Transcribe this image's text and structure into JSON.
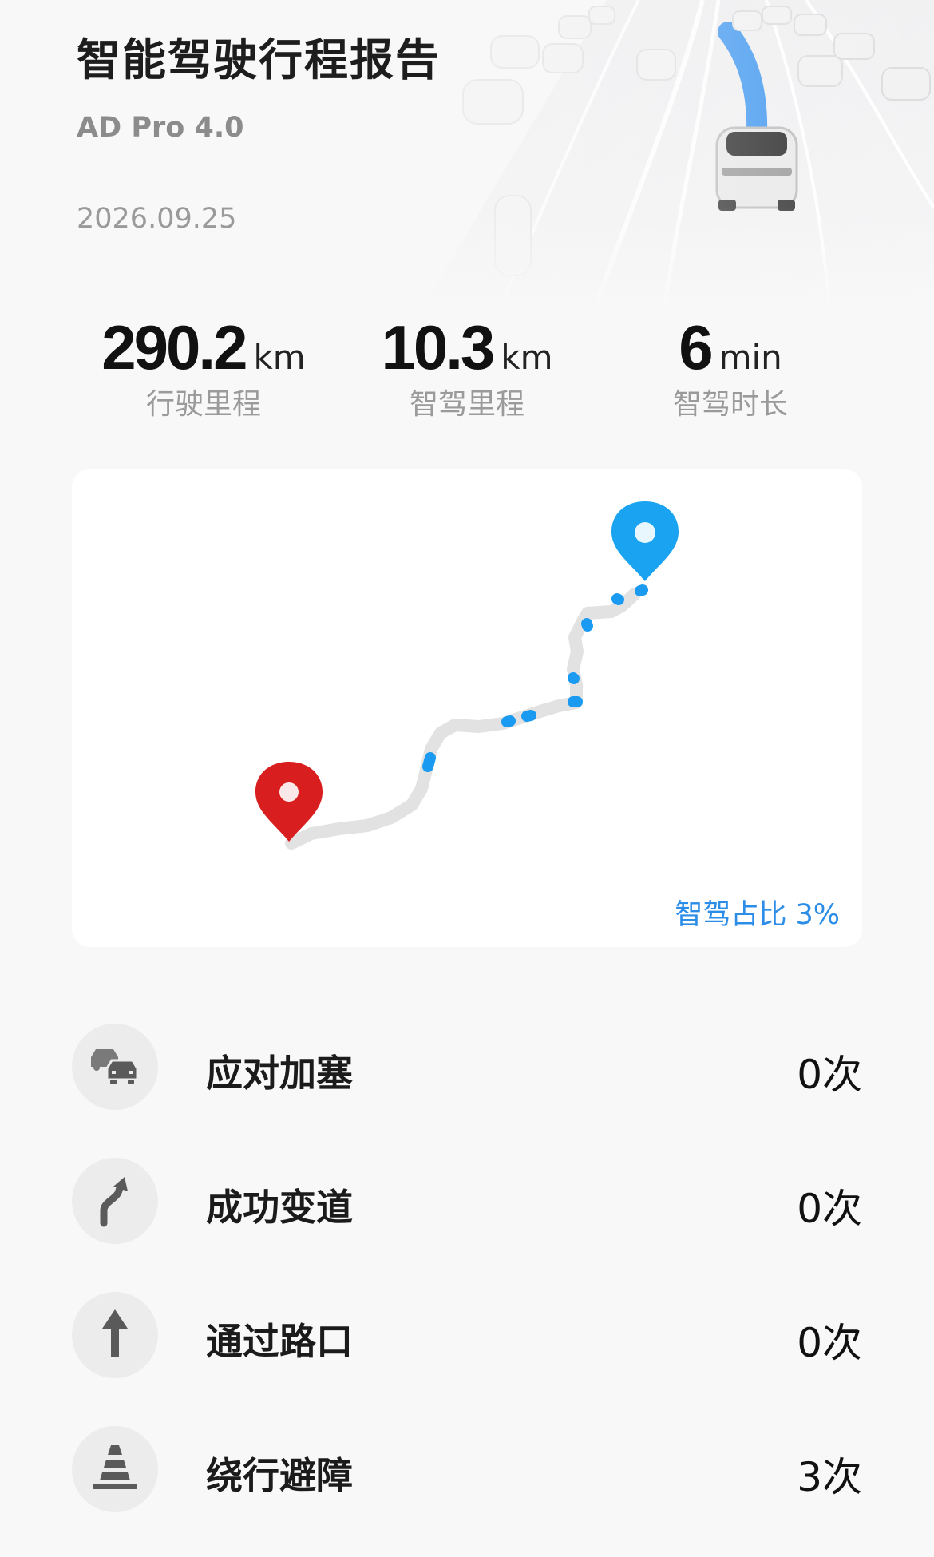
{
  "report": {
    "title": "智能驾驶行程报告",
    "subtitle": "AD Pro 4.0",
    "date": "2026.09.25"
  },
  "stats": [
    {
      "value": "290.2",
      "unit": "km",
      "label": "行驶里程"
    },
    {
      "value": "10.3",
      "unit": "km",
      "label": "智驾里程"
    },
    {
      "value": "6",
      "unit": "min",
      "label": "智驾时长"
    }
  ],
  "map": {
    "ratio_label": "智驾占比 3%",
    "start_pin_color": "#1aa3f0",
    "end_pin_color": "#d81e1e",
    "route_color": "#e2e2e2",
    "assist_segment_color": "#1a9af0"
  },
  "events": [
    {
      "icon": "traffic-jam-icon",
      "label": "应对加塞",
      "count": "0次"
    },
    {
      "icon": "lane-change-icon",
      "label": "成功变道",
      "count": "0次"
    },
    {
      "icon": "intersection-arrow-icon",
      "label": "通过路口",
      "count": "0次"
    },
    {
      "icon": "traffic-cone-icon",
      "label": "绕行避障",
      "count": "3次"
    }
  ]
}
